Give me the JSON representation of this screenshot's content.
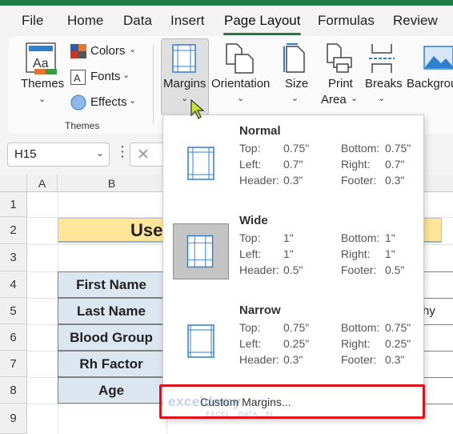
{
  "tabs": [
    "File",
    "Home",
    "Data",
    "Insert",
    "Page Layout",
    "Formulas",
    "Review"
  ],
  "ribbon": {
    "themes_label": "Themes",
    "colors_label": "Colors",
    "fonts_label": "Fonts",
    "effects_label": "Effects",
    "group_label": "Themes",
    "margins_label": "Margins",
    "orientation_label": "Orientation",
    "size_label": "Size",
    "print_area_line1": "Print",
    "print_area_line2": "Area",
    "breaks_label": "Breaks",
    "background_label": "Backgrou"
  },
  "formula_bar": {
    "name_box": "H15",
    "dots": "⋮",
    "cancel_glyph": "✕"
  },
  "grid": {
    "columns": [
      "A",
      "B"
    ],
    "rows": [
      "1",
      "2",
      "3",
      "4",
      "5",
      "6",
      "7",
      "8",
      "9"
    ],
    "title_fragment": "Use",
    "labels": [
      "First Name",
      "Last Name",
      "Blood Group",
      "Rh Factor",
      "Age"
    ],
    "last_name_value_fragment": "hy"
  },
  "margins_menu": {
    "options": [
      {
        "name": "Normal",
        "top_label": "Top:",
        "top": "0.75\"",
        "bottom_label": "Bottom:",
        "bottom": "0.75\"",
        "left_label": "Left:",
        "left": "0.7\"",
        "right_label": "Right:",
        "right": "0.7\"",
        "header_label": "Header:",
        "header": "0.3\"",
        "footer_label": "Footer:",
        "footer": "0.3\""
      },
      {
        "name": "Wide",
        "top_label": "Top:",
        "top": "1\"",
        "bottom_label": "Bottom:",
        "bottom": "1\"",
        "left_label": "Left:",
        "left": "1\"",
        "right_label": "Right:",
        "right": "1\"",
        "header_label": "Header:",
        "header": "0.5\"",
        "footer_label": "Footer:",
        "footer": "0.5\""
      },
      {
        "name": "Narrow",
        "top_label": "Top:",
        "top": "0.75\"",
        "bottom_label": "Bottom:",
        "bottom": "0.75\"",
        "left_label": "Left:",
        "left": "0.25\"",
        "right_label": "Right:",
        "right": "0.25\"",
        "header_label": "Header:",
        "header": "0.3\"",
        "footer_label": "Footer:",
        "footer": "0.3\""
      }
    ],
    "selected": "Wide",
    "custom_label": "Custom Margins..."
  },
  "watermark": {
    "brand": "exceldemy",
    "tagline": "EXCEL · DATA · BI"
  },
  "colors": {
    "accent": "#1f7a46",
    "highlight": "#e0101a",
    "title_fill": "#ffe699",
    "label_fill": "#dce6f1",
    "icon_blue": "#2f7fd0"
  }
}
